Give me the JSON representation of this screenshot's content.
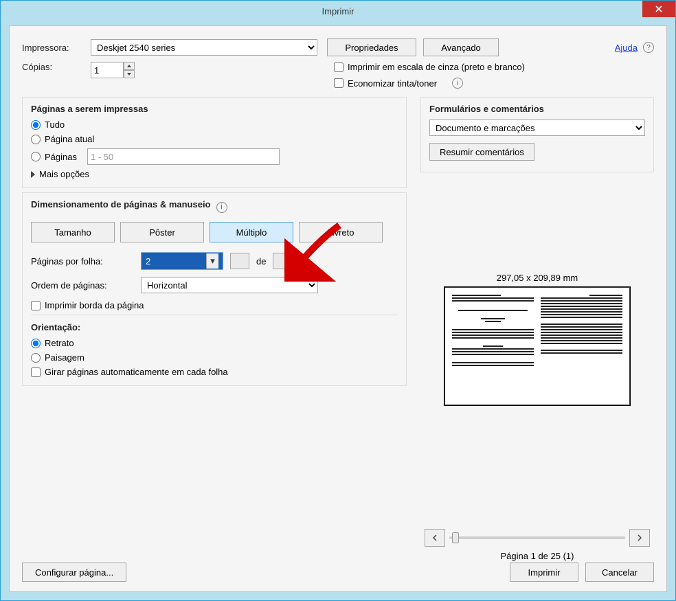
{
  "window": {
    "title": "Imprimir"
  },
  "header": {
    "printer_label": "Impressora:",
    "printer_value": "Deskjet 2540 series",
    "properties_btn": "Propriedades",
    "advanced_btn": "Avançado",
    "help_link": "Ajuda",
    "copies_label": "Cópias:",
    "copies_value": "1",
    "grayscale_label": "Imprimir em escala de cinza (preto e branco)",
    "savetoner_label": "Economizar tinta/toner"
  },
  "pages": {
    "group_title": "Páginas a serem impressas",
    "all": "Tudo",
    "current": "Página atual",
    "pages_label": "Páginas",
    "pages_value": "1 - 50",
    "more": "Mais opções"
  },
  "sizing": {
    "group_title": "Dimensionamento de páginas & manuseio",
    "size_btn": "Tamanho",
    "poster_btn": "Pôster",
    "multiple_btn": "Múltiplo",
    "booklet_btn": "Livreto",
    "pages_per_sheet_label": "Páginas por folha:",
    "pages_per_sheet_value": "2",
    "of_label": "de",
    "page_order_label": "Ordem de páginas:",
    "page_order_value": "Horizontal",
    "print_border_label": "Imprimir borda da página"
  },
  "orientation": {
    "group_title": "Orientação:",
    "portrait": "Retrato",
    "landscape": "Paisagem",
    "autorotate": "Girar páginas automaticamente em cada folha"
  },
  "forms": {
    "group_title": "Formulários e comentários",
    "select_value": "Documento e marcações",
    "summarize_btn": "Resumir comentários"
  },
  "preview": {
    "dimensions": "297,05 x 209,89 mm",
    "page_counter": "Página 1 de 25 (1)"
  },
  "footer": {
    "page_setup_btn": "Configurar página...",
    "print_btn": "Imprimir",
    "cancel_btn": "Cancelar"
  }
}
